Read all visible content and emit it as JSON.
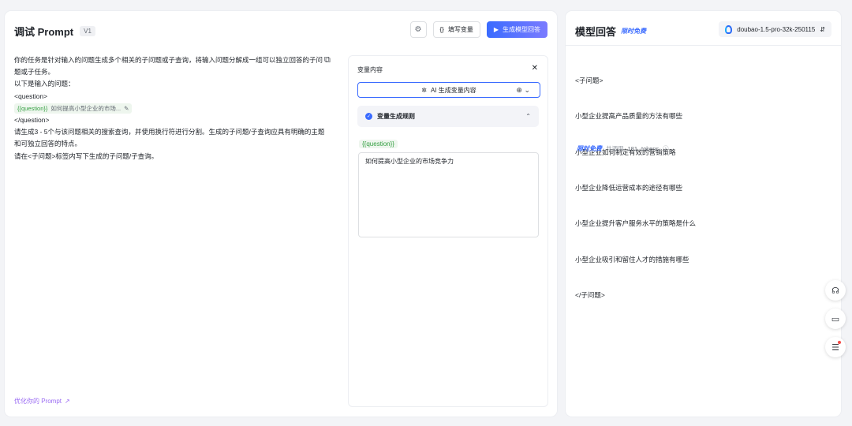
{
  "left": {
    "title": "调试 Prompt",
    "version": "V1",
    "toolbar": {
      "fill_vars_label": "填写变量",
      "generate_label": "生成模型回答"
    },
    "prompt_lines": [
      "你的任务是针对输入的问题生成多个相关的子问题或子查询，将输入问题分解成一组可以独立回答的子问",
      "题或子任务。",
      "以下是输入的问题：",
      "<question>"
    ],
    "var_chip": {
      "name": "{{question}}",
      "value": "如何提高小型企业的市场..."
    },
    "prompt_lines_after": [
      "</question>",
      "请生成3 - 5个与该问题相关的搜索查询，并使用换行符进行分割。生成的子问题/子查询应具有明确的主题",
      "和可独立回答的特点。",
      "请在<子问题>标签内写下生成的子问题/子查询。"
    ],
    "optimize_link": "优化你的 Prompt"
  },
  "variables": {
    "header": "变量内容",
    "ai_generate_label": "AI 生成变量内容",
    "rules_label": "变量生成规则",
    "var_name": "{{question}}",
    "var_value": "如何提高小型企业的市场竞争力"
  },
  "right": {
    "title": "模型回答",
    "free_badge": "限时免费",
    "model_name": "doubao-1.5-pro-32k-250115",
    "answer_lines": [
      "<子问题>",
      "小型企业提高产品质量的方法有哪些",
      "小型企业如何制定有效的营销策略",
      "小型企业降低运营成本的途径有哪些",
      "小型企业提升客户服务水平的策略是什么",
      "小型企业吸引和留住人才的措施有哪些",
      "</子问题>"
    ],
    "usage_badge": "限时免费",
    "usage_prefix": "共调用",
    "usage_tokens": "181",
    "usage_suffix": "tokens"
  },
  "accent": "#3a6bff"
}
